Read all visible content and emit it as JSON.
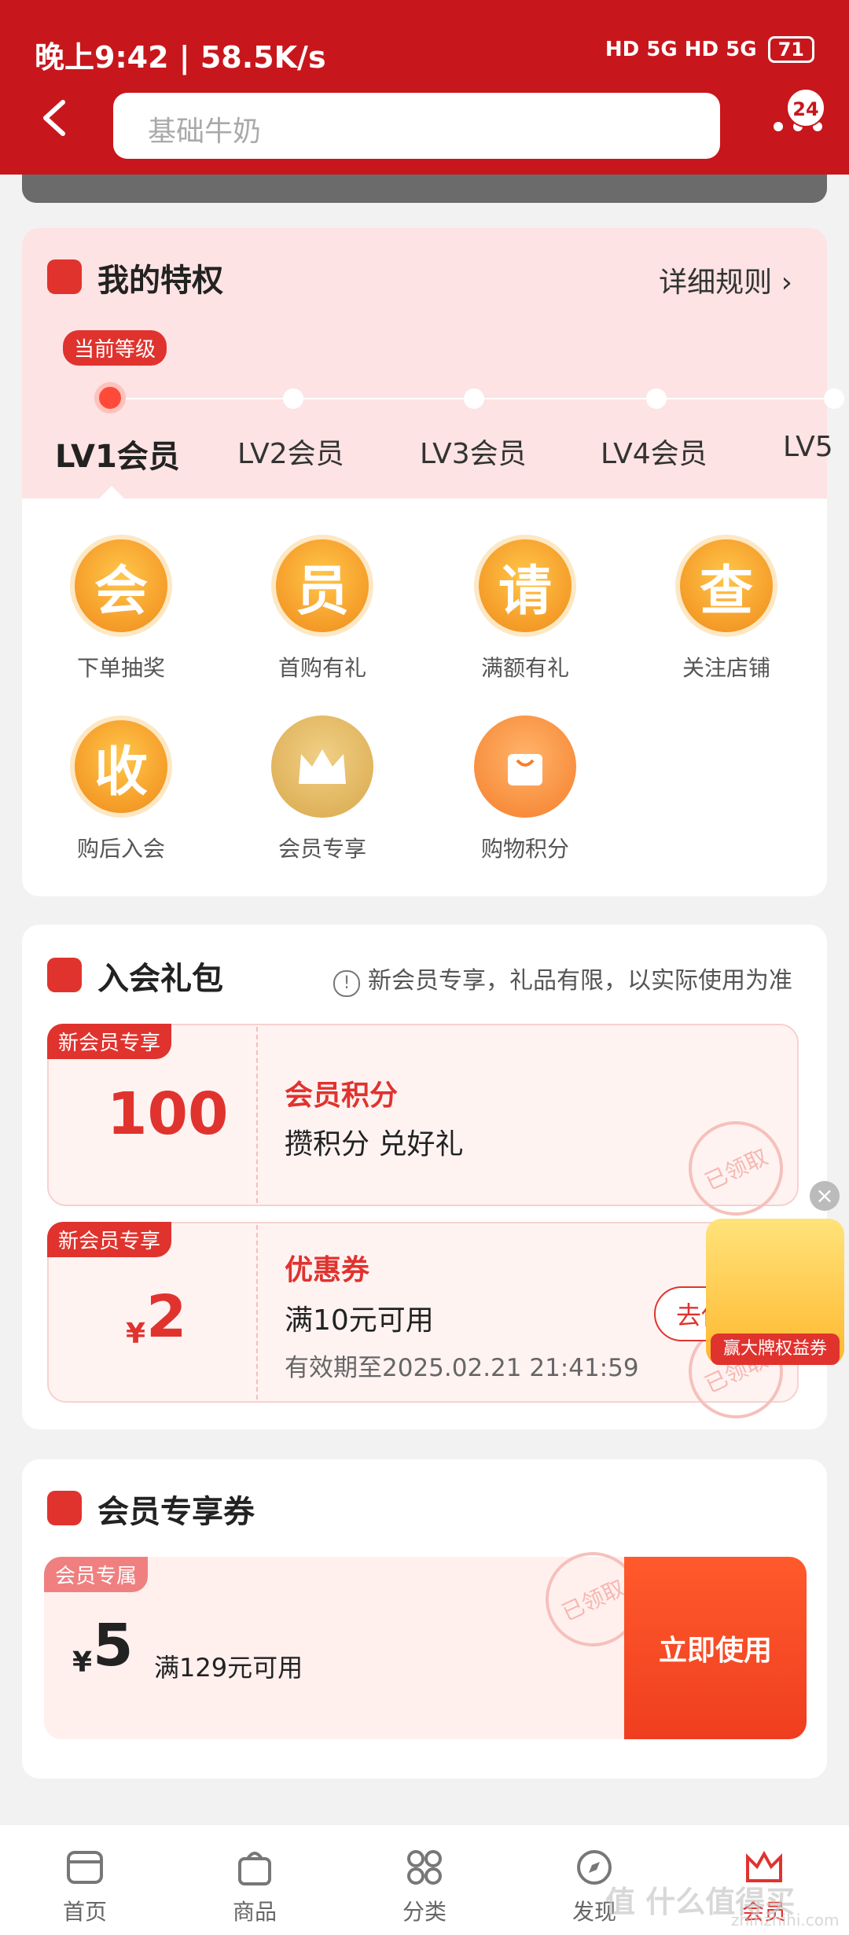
{
  "status": {
    "left": "晚上9:42 | 58.5K/s",
    "battery": "71",
    "network": "HD 5G HD 5G"
  },
  "header": {
    "search_placeholder": "基础牛奶",
    "badge": "24"
  },
  "privilege": {
    "title": "我的特权",
    "rules": "详细规则 ›",
    "current_tag": "当前等级",
    "levels": [
      "LV1会员",
      "LV2会员",
      "LV3会员",
      "LV4会员",
      "LV5"
    ],
    "perks": [
      {
        "char": "会",
        "label": "下单抽奖"
      },
      {
        "char": "员",
        "label": "首购有礼"
      },
      {
        "char": "请",
        "label": "满额有礼"
      },
      {
        "char": "查",
        "label": "关注店铺"
      },
      {
        "char": "收",
        "label": "购后入会"
      },
      {
        "char": "",
        "label": "会员专享"
      },
      {
        "char": "",
        "label": "购物积分"
      }
    ]
  },
  "gift": {
    "title": "入会礼包",
    "note": "新会员专享，礼品有限，以实际使用为准",
    "coupons": [
      {
        "tag": "新会员专享",
        "value": "100",
        "title": "会员积分",
        "main": "攒积分 兑好礼",
        "stamp": "已领取"
      },
      {
        "tag": "新会员专享",
        "currency": "¥",
        "value": "2",
        "title": "优惠券",
        "main": "满10元可用",
        "sub": "有效期至2025.02.21 21:41:59",
        "button": "去使",
        "stamp": "已领取"
      }
    ],
    "float_ad": "赢大牌权益券"
  },
  "member_coupon": {
    "title": "会员专享券",
    "tag": "会员专属",
    "currency": "¥",
    "value": "5",
    "condition": "满129元可用",
    "stamp": "已领取",
    "button": "立即使用"
  },
  "tabs": [
    {
      "label": "首页"
    },
    {
      "label": "商品"
    },
    {
      "label": "分类"
    },
    {
      "label": "发现"
    },
    {
      "label": "会员"
    }
  ],
  "watermark": {
    "main": "值 什么值得买",
    "sub": "zhihzhihi.com"
  },
  "colors": {
    "brand": "#c8161d",
    "accent": "#e0332e"
  }
}
